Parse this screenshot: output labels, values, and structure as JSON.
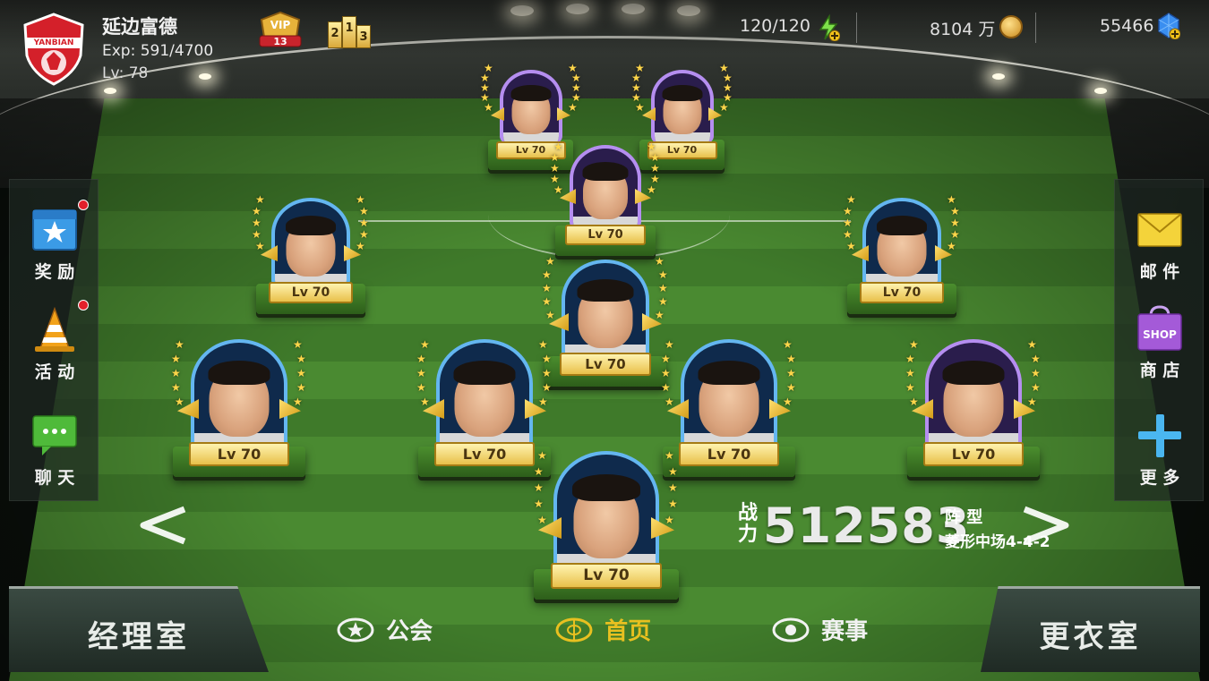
{
  "header": {
    "crest_text": "YANBIAN",
    "club_name": "延边富德",
    "exp": "Exp: 591/4700",
    "level": "Lv: 78",
    "vip_label": "VIP",
    "vip_level": "13",
    "rank_digits": [
      "2",
      "1",
      "3"
    ],
    "energy": "120/120",
    "money": "8104 万",
    "gems": "55466"
  },
  "left_menu": [
    {
      "label": "奖 励",
      "icon": "reward-star-icon",
      "has_dot": true
    },
    {
      "label": "活 动",
      "icon": "traffic-cone-icon",
      "has_dot": true
    },
    {
      "label": "聊 天",
      "icon": "chat-bubble-icon",
      "has_dot": false
    }
  ],
  "right_menu": [
    {
      "label": "邮 件",
      "icon": "mail-envelope-icon"
    },
    {
      "label": "商 店",
      "icon": "shop-bag-icon",
      "badge": "SHOP"
    },
    {
      "label": "更 多",
      "icon": "plus-icon"
    }
  ],
  "players": [
    {
      "id": "fw-left",
      "level": "Lv 70",
      "frame": "purple"
    },
    {
      "id": "fw-right",
      "level": "Lv 70",
      "frame": "purple"
    },
    {
      "id": "am",
      "level": "Lv 70",
      "frame": "purple"
    },
    {
      "id": "lm",
      "level": "Lv 70",
      "frame": "blue"
    },
    {
      "id": "rm",
      "level": "Lv 70",
      "frame": "blue"
    },
    {
      "id": "dm",
      "level": "Lv 70",
      "frame": "blue"
    },
    {
      "id": "lb",
      "level": "Lv 70",
      "frame": "blue"
    },
    {
      "id": "lcb",
      "level": "Lv 70",
      "frame": "blue"
    },
    {
      "id": "rcb",
      "level": "Lv 70",
      "frame": "blue"
    },
    {
      "id": "rb",
      "level": "Lv 70",
      "frame": "purple"
    },
    {
      "id": "gk",
      "level": "Lv 70",
      "frame": "blue"
    }
  ],
  "power": {
    "label": "战力",
    "value": "512583",
    "formation_label": "阵 型",
    "formation_value": "菱形中场4-4-2"
  },
  "bottom_nav": {
    "manager_office": "经理室",
    "guild": "公会",
    "home": "首页",
    "match": "赛事",
    "locker_room": "更衣室"
  },
  "colors": {
    "accent_gold": "#e6c243",
    "active_tab": "#e8c020",
    "inactive_tab": "#f2f2f2",
    "badge_red": "#e2202a",
    "pitch_green": "#3f7a2a"
  }
}
